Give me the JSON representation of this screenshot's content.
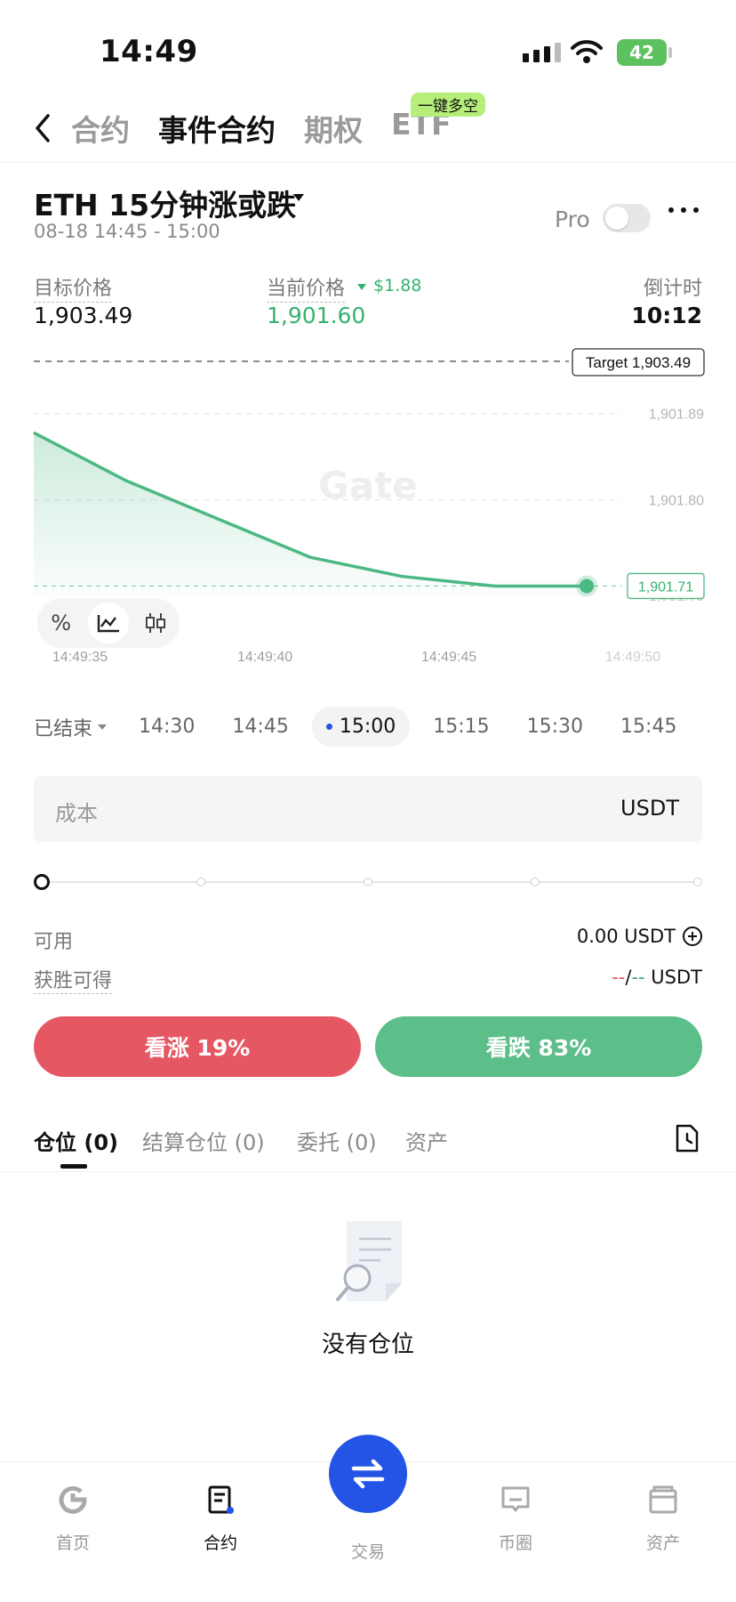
{
  "status_bar": {
    "time": "14:49",
    "battery": "42"
  },
  "nav": {
    "tabs": [
      "合约",
      "事件合约",
      "期权",
      "ETF"
    ],
    "active_tab": "事件合约",
    "etf_badge": "一键多空"
  },
  "market": {
    "title": "ETH 15分钟涨或跌",
    "time_range": "08-18 14:45 - 15:00",
    "pro_label": "Pro",
    "pro_enabled": false
  },
  "prices": {
    "target_label": "目标价格",
    "target_value": "1,903.49",
    "current_label": "当前价格",
    "current_delta": "$1.88",
    "current_value": "1,901.60",
    "countdown_label": "倒计时",
    "countdown_value": "10:12"
  },
  "chart_data": {
    "type": "area",
    "x": [
      "14:49:35",
      "14:49:37",
      "14:49:39",
      "14:49:41",
      "14:49:43",
      "14:49:45",
      "14:49:47"
    ],
    "values": [
      1901.87,
      1901.82,
      1901.78,
      1901.74,
      1901.72,
      1901.71,
      1901.71
    ],
    "x_ticks": [
      "14:49:35",
      "14:49:40",
      "14:49:45",
      "14:49:50"
    ],
    "y_ticks": [
      "1,901.89",
      "1,901.80"
    ],
    "ylim": [
      1901.69,
      1901.95
    ],
    "target_line_label": "Target 1,903.49",
    "current_label": "1,901.71",
    "partial_tick": "1,901.70",
    "watermark": "Gate",
    "line_color": "#4cb883"
  },
  "chart_tools": [
    "%",
    "line",
    "candle"
  ],
  "expiry": {
    "ended_label": "已结束",
    "times": [
      "14:30",
      "14:45",
      "15:00",
      "15:15",
      "15:30",
      "15:45"
    ],
    "selected": "15:00"
  },
  "order": {
    "cost_placeholder": "成本",
    "cost_unit": "USDT",
    "slider_value": 0,
    "available_label": "可用",
    "available_value": "0.00 USDT",
    "win_label": "获胜可得",
    "win_red": "--",
    "win_slash": "/",
    "win_green": "--",
    "win_unit": " USDT"
  },
  "bet": {
    "up_label": "看涨 19%",
    "down_label": "看跌 83%"
  },
  "positions": {
    "tabs": [
      "仓位 (0)",
      "结算仓位 (0)",
      "委托 (0)",
      "资产"
    ],
    "empty_text": "没有仓位"
  },
  "bottom_nav": [
    {
      "label": "首页",
      "icon": "gate-logo-icon"
    },
    {
      "label": "合约",
      "icon": "contract-icon"
    },
    {
      "label": "交易",
      "icon": "swap-icon"
    },
    {
      "label": "币圈",
      "icon": "chat-icon"
    },
    {
      "label": "资产",
      "icon": "wallet-icon"
    }
  ],
  "colors": {
    "up": "#e55763",
    "down": "#5cbe88",
    "brand_blue": "#2354e6",
    "badge_green": "#b6ee7a"
  }
}
